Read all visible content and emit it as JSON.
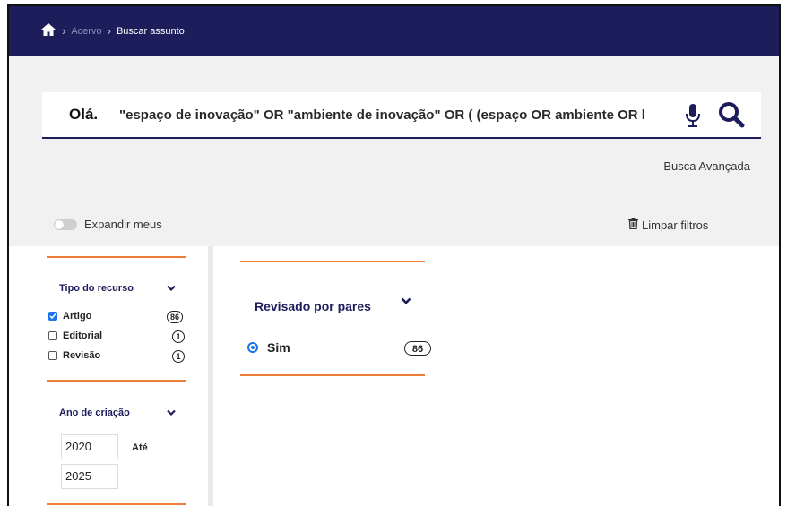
{
  "breadcrumb": {
    "home_icon": "home-icon",
    "items": [
      {
        "label": "Acervo"
      },
      {
        "label": "Buscar assunto"
      }
    ]
  },
  "search": {
    "greeting": "Olá.",
    "query": "\"espaço de inovação\" OR \"ambiente de inovação\" OR ( (espaço OR ambiente OR l",
    "advanced_label": "Busca Avançada"
  },
  "toolbar": {
    "expand_label": "Expandir meus",
    "clear_label": "Limpar filtros"
  },
  "filters": {
    "tipo_recurso": {
      "title": "Tipo do recurso",
      "options": [
        {
          "label": "Artigo",
          "count": "86",
          "checked": true
        },
        {
          "label": "Editorial",
          "count": "1",
          "checked": false
        },
        {
          "label": "Revisão",
          "count": "1",
          "checked": false
        }
      ]
    },
    "ano_criacao": {
      "title": "Ano de criação",
      "from": "2020",
      "to_label": "Até",
      "to": "2025"
    }
  },
  "main": {
    "title": "Revisado por pares",
    "option": {
      "label": "Sim",
      "count": "86",
      "selected": true
    }
  },
  "colors": {
    "navy": "#1e1d5c",
    "orange": "#ef7d3a",
    "blue": "#1a73e8"
  }
}
